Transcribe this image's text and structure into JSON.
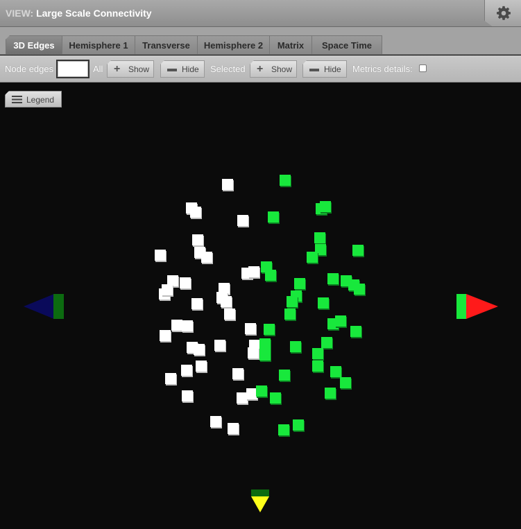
{
  "view": {
    "prefix": "VIEW:",
    "title": "Large Scale Connectivity"
  },
  "icons": {
    "settings": "gear-icon",
    "plus": "plus-icon",
    "minus": "minus-icon",
    "legend": "list-icon"
  },
  "tabs": [
    {
      "label": "3D Edges",
      "active": true
    },
    {
      "label": "Hemisphere 1",
      "active": false
    },
    {
      "label": "Transverse",
      "active": false
    },
    {
      "label": "Hemisphere 2",
      "active": false
    },
    {
      "label": "Matrix",
      "active": false
    },
    {
      "label": "Space Time",
      "active": false
    }
  ],
  "toolbar": {
    "node_edges_label": "Node edges",
    "all_label": "All",
    "show_label": "Show",
    "hide_label": "Hide",
    "selected_label": "Selected",
    "metrics_label": "Metrics details:"
  },
  "legend": {
    "label": "Legend"
  },
  "colors": {
    "left_nodes": "#ffffff",
    "right_nodes": "#18e83c",
    "x_axis_arrow": "#ff1a1a",
    "neg_x_arrow": "#0a0a5a",
    "y_axis_arrow": "#ffff1a",
    "axis_base": "#0c6b10"
  }
}
